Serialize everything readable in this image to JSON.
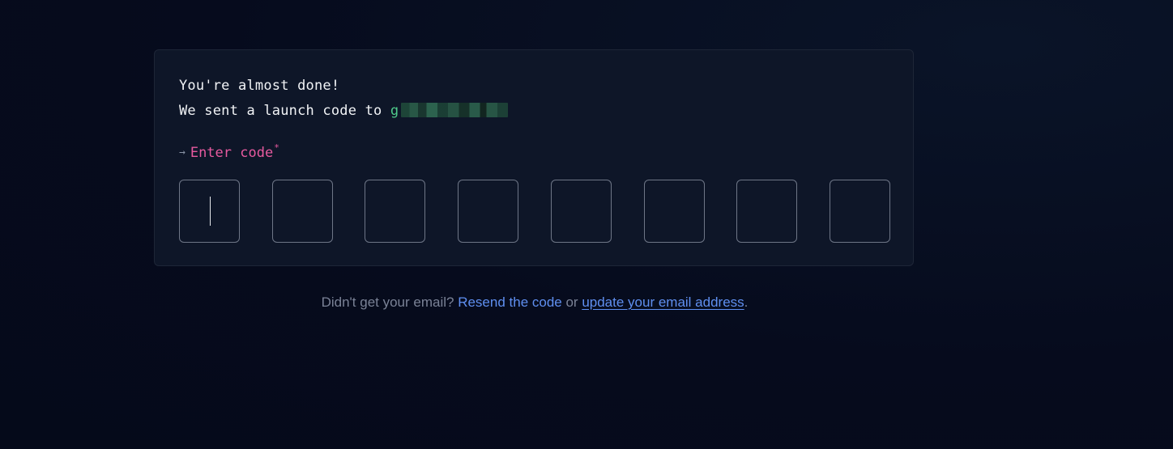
{
  "card": {
    "line1": "You're almost done!",
    "line2_prefix": "We sent a launch code to ",
    "email_visible": "g",
    "label": "Enter code",
    "required_mark": "*",
    "arrow": "→",
    "code_boxes": [
      "",
      "",
      "",
      "",
      "",
      "",
      "",
      ""
    ]
  },
  "footer": {
    "prefix": "Didn't get your email? ",
    "resend_label": "Resend the code",
    "middle": " or ",
    "update_label": "update your email address",
    "suffix": "."
  },
  "colors": {
    "background": "#060b1d",
    "card": "#0e1628",
    "accent_pink": "#e75a9f",
    "accent_green": "#4ec98a",
    "link_blue": "#5f8ff0"
  }
}
